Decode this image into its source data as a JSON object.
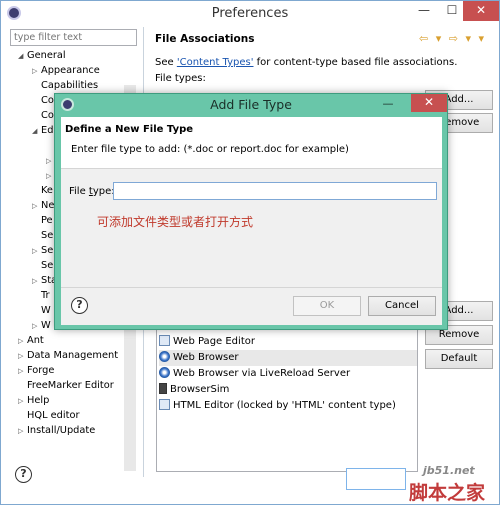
{
  "window": {
    "title": "Preferences",
    "minimize": "—",
    "maximize": "☐",
    "close": "✕"
  },
  "filter": {
    "placeholder": "type filter text"
  },
  "tree": {
    "items": [
      {
        "label": "General",
        "arrow": "◢"
      },
      {
        "label": "Appearance",
        "arrow": "▷"
      },
      {
        "label": "Capabilities",
        "arrow": ""
      },
      {
        "label": "Co",
        "arrow": ""
      },
      {
        "label": "Co",
        "arrow": ""
      },
      {
        "label": "Ed",
        "arrow": "◢"
      },
      {
        "label": "",
        "arrow": "▷"
      },
      {
        "label": "",
        "arrow": "▷"
      },
      {
        "label": "Ke",
        "arrow": ""
      },
      {
        "label": "Ne",
        "arrow": "▷"
      },
      {
        "label": "Pe",
        "arrow": ""
      },
      {
        "label": "Se",
        "arrow": ""
      },
      {
        "label": "Se",
        "arrow": "▷"
      },
      {
        "label": "Se",
        "arrow": ""
      },
      {
        "label": "Sta",
        "arrow": "▷"
      },
      {
        "label": "Tr",
        "arrow": ""
      },
      {
        "label": "W",
        "arrow": ""
      },
      {
        "label": "W",
        "arrow": "▷"
      },
      {
        "label": "Ant",
        "arrow": "▷"
      },
      {
        "label": "Data Management",
        "arrow": "▷"
      },
      {
        "label": "Forge",
        "arrow": "▷"
      },
      {
        "label": "FreeMarker Editor",
        "arrow": ""
      },
      {
        "label": "Help",
        "arrow": "▷"
      },
      {
        "label": "HQL editor",
        "arrow": ""
      },
      {
        "label": "Install/Update",
        "arrow": "▷"
      }
    ]
  },
  "panel": {
    "title": "File Associations",
    "nav": "⇦ ▾ ⇨ ▾ ▾",
    "see_prefix": "See ",
    "see_link": "'Content Types'",
    "see_suffix": " for content-type based file associations.",
    "file_types_label": "File types:",
    "add_top": "Add...",
    "remove_top": "Remove",
    "add_bottom": "Add...",
    "remove_bottom": "Remove",
    "default": "Default"
  },
  "editors": [
    {
      "label": "Web Page Editor",
      "icon": "page"
    },
    {
      "label": "Web Browser",
      "icon": "globe"
    },
    {
      "label": "Web Browser via LiveReload Server",
      "icon": "globe"
    },
    {
      "label": "BrowserSim",
      "icon": "phone"
    },
    {
      "label": "HTML Editor (locked by 'HTML' content type)",
      "icon": "page"
    }
  ],
  "dialog": {
    "title": "Add File Type",
    "minimize": "—",
    "close": "✕",
    "heading": "Define a New File Type",
    "description": "Enter file type to add: (*.doc or report.doc for example)",
    "file_type_label_prefix": "File ",
    "file_type_label_mnemonic": "t",
    "file_type_label_suffix": "ype:",
    "file_type_value": "",
    "annotation": "可添加文件类型或者打开方式",
    "ok": "OK",
    "cancel": "Cancel",
    "help": "?"
  },
  "help": "?",
  "watermark": {
    "url": "jb51.net",
    "cn": "脚本之家"
  }
}
